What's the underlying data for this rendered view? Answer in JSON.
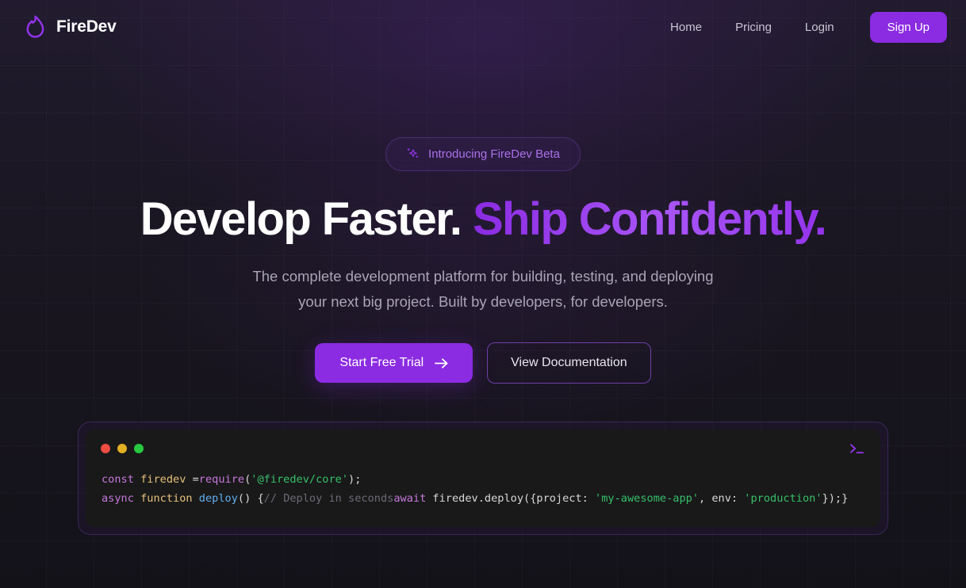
{
  "brand": {
    "name": "FireDev",
    "icon": "flame-icon"
  },
  "nav": {
    "links": [
      {
        "label": "Home"
      },
      {
        "label": "Pricing"
      },
      {
        "label": "Login"
      }
    ],
    "signup_label": "Sign Up"
  },
  "hero": {
    "badge": {
      "icon": "sparkles-icon",
      "text": "Introducing FireDev Beta"
    },
    "headline_white": "Develop Faster.",
    "headline_accent": "Ship Confidently.",
    "subtitle_line1": "The complete development platform for building, testing, and deploying",
    "subtitle_line2": "your next big project. Built by developers, for developers.",
    "cta_primary": "Start Free Trial",
    "cta_primary_icon": "arrow-right-icon",
    "cta_secondary": "View Documentation"
  },
  "terminal": {
    "prompt_icon": "terminal-prompt-icon",
    "dots": [
      "close-dot-red",
      "minimize-dot-yellow",
      "maximize-dot-green"
    ],
    "line1": {
      "kw_const": "const",
      "space1": " ",
      "var_name": "firedev",
      "equals": " =",
      "fn_require": "require",
      "paren_open": "(",
      "module": "'@firedev/core'",
      "paren_close": ");"
    },
    "line2": {
      "kw_async": "async",
      "space1": " ",
      "kw_function": "function",
      "space2": " ",
      "fn_deploy": "deploy",
      "parens": "() {",
      "comment": "// Deploy in seconds",
      "kw_await": "await",
      "call": " firedev.deploy({project: ",
      "str_project": "'my-awesome-app'",
      "env_key": ", env: ",
      "str_env": "'production'",
      "tail": "});}"
    }
  },
  "colors": {
    "accent": "#8b2be2",
    "accent_light": "#a855f7",
    "background": "#17141f",
    "terminal_bg": "#191919"
  }
}
